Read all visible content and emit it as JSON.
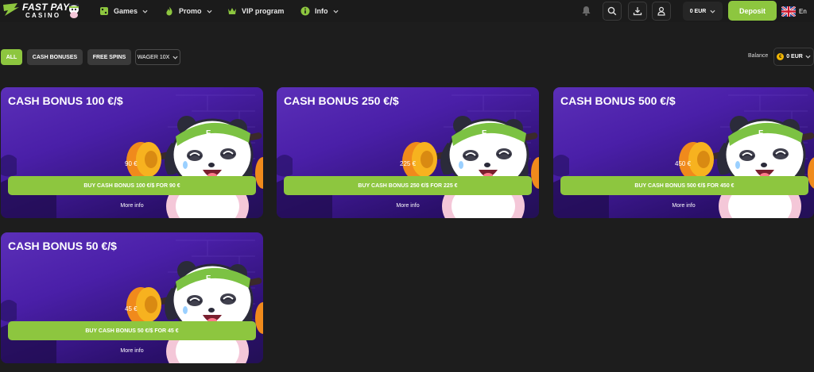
{
  "header": {
    "logo_line1": "FAST PAY",
    "logo_line2": "CASINO",
    "nav": [
      {
        "label": "Games"
      },
      {
        "label": "Promo"
      },
      {
        "label": "VIP program"
      },
      {
        "label": "Info"
      }
    ],
    "balance": "0 EUR",
    "deposit_label": "Deposit",
    "language": "En"
  },
  "filters": {
    "all": "ALL",
    "cash_bonuses": "CASH BONUSES",
    "free_spins": "FREE SPINS",
    "wager": "WAGER 10X"
  },
  "balance": {
    "label": "Balance",
    "value": "0 EUR"
  },
  "cards": [
    {
      "title": "CASH BONUS 100 €/$",
      "price": "90 €",
      "buy_label": "BUY CASH BONUS 100 €/$ FOR 90 €",
      "more_label": "More info"
    },
    {
      "title": "CASH BONUS 250 €/$",
      "price": "225 €",
      "buy_label": "BUY CASH BONUS 250 €/$ FOR 225 €",
      "more_label": "More info"
    },
    {
      "title": "CASH BONUS 500 €/$",
      "price": "450 €",
      "buy_label": "BUY CASH BONUS 500 €/$ FOR 450 €",
      "more_label": "More info"
    },
    {
      "title": "CASH BONUS 50 €/$",
      "price": "45 €",
      "buy_label": "BUY CASH BONUS 50 €/$ FOR 45 €",
      "more_label": "More info"
    }
  ],
  "colors": {
    "accent": "#8dc63f",
    "background": "#1d1d1d",
    "card_purple": "#4a1fa8"
  }
}
